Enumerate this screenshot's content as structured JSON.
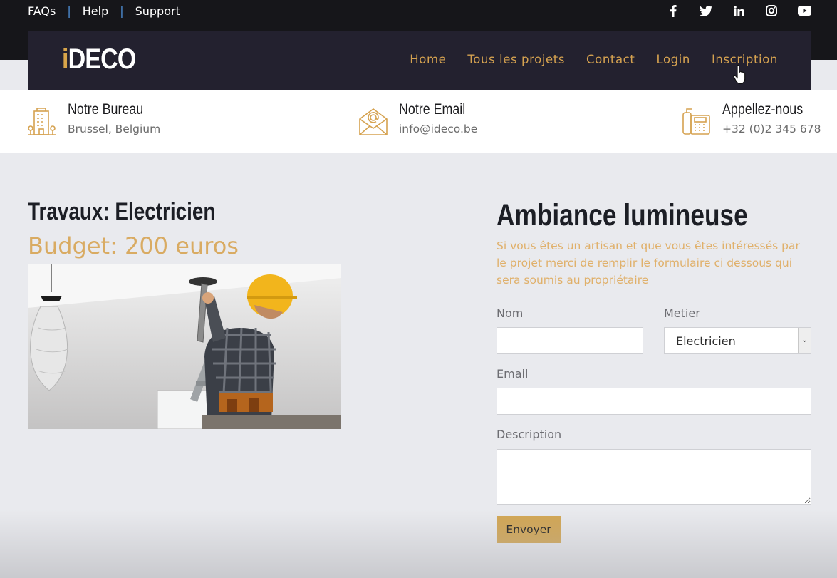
{
  "topbar": {
    "links": [
      "FAQs",
      "Help",
      "Support"
    ],
    "social": [
      "facebook-icon",
      "twitter-icon",
      "linkedin-icon",
      "instagram-icon",
      "youtube-icon"
    ]
  },
  "navbar": {
    "logo_i": "i",
    "logo_rest": "DECO",
    "items": [
      "Home",
      "Tous les projets",
      "Contact",
      "Login",
      "Inscription"
    ]
  },
  "info": {
    "office": {
      "title": "Notre Bureau",
      "value": "Brussel, Belgium",
      "icon": "building-icon"
    },
    "email": {
      "title": "Notre Email",
      "value": "info@ideco.be",
      "icon": "envelope-icon"
    },
    "phone": {
      "title": "Appellez-nous",
      "value": "+32 (0)2 345 678",
      "icon": "phone-icon"
    }
  },
  "project": {
    "title": "Travaux: Electricien",
    "budget": "Budget: 200 euros"
  },
  "form": {
    "title": "Ambiance lumineuse",
    "description": "Si vous êtes un artisan et que vous êtes intéressés par le projet merci de remplir le formulaire ci dessous qui sera soumis au propriétaire",
    "nom_label": "Nom",
    "nom_value": "",
    "metier_label": "Metier",
    "metier_value": "Electricien",
    "email_label": "Email",
    "email_value": "",
    "description_label": "Description",
    "description_value": "",
    "submit_label": "Envoyer"
  },
  "colors": {
    "accent": "#d5a250",
    "dark": "#23212f",
    "topbar": "#16161a",
    "background": "#e9eaee"
  }
}
